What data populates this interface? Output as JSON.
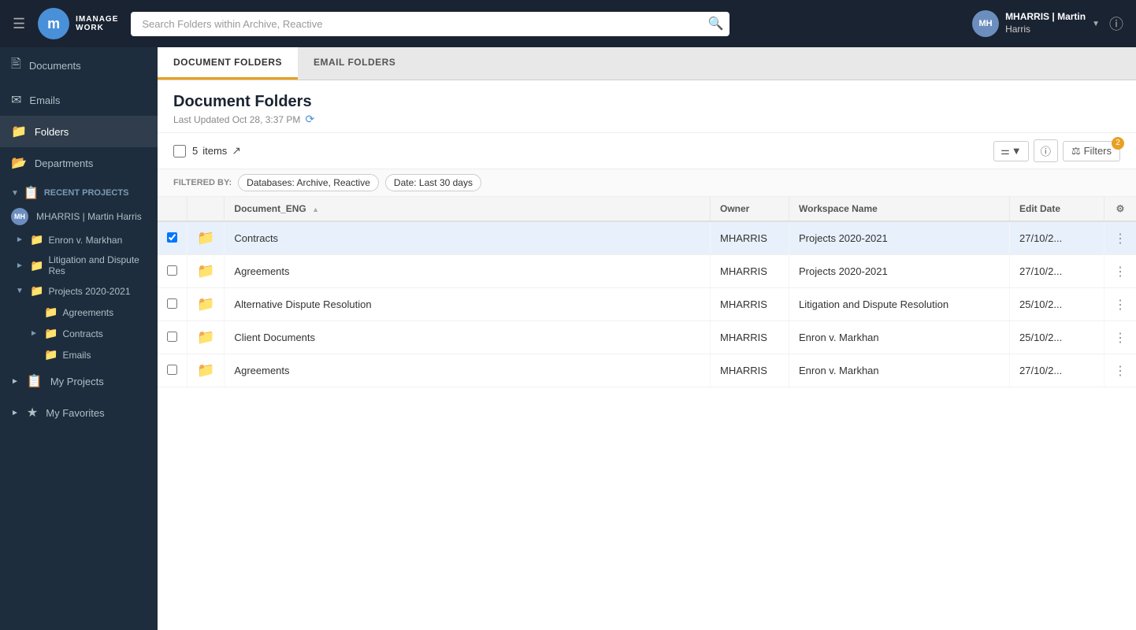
{
  "app": {
    "logo_letter": "m",
    "logo_brand": "iManage",
    "logo_product": "Work"
  },
  "topbar": {
    "search_placeholder": "Search Folders within Archive, Reactive",
    "user_initials": "MH",
    "user_username": "MHARRIS | Martin",
    "user_fullname": "Harris",
    "user_display": "MHARRIS | Martin Harris"
  },
  "sidebar": {
    "documents_label": "Documents",
    "emails_label": "Emails",
    "folders_label": "Folders",
    "departments_label": "Departments",
    "recent_projects_label": "Recent Projects",
    "my_projects_label": "My Projects",
    "my_favorites_label": "My Favorites",
    "user_label": "MHARRIS | Martin Harris",
    "tree": {
      "enron": "Enron v. Markhan",
      "litigation": "Litigation and Dispute Res",
      "projects": "Projects 2020-2021",
      "agreements": "Agreements",
      "contracts": "Contracts",
      "emails": "Emails"
    }
  },
  "tabs": {
    "document_folders": "DOCUMENT FOLDERS",
    "email_folders": "EMAIL FOLDERS"
  },
  "content": {
    "title": "Document Folders",
    "last_updated_label": "Last Updated Oct 28, 3:37 PM",
    "items_count": "5",
    "items_label": "items"
  },
  "filter": {
    "filtered_by_label": "FILTERED BY:",
    "chip1": "Databases: Archive, Reactive",
    "chip2": "Date: Last 30 days"
  },
  "toolbar": {
    "filter_label": "Filters",
    "filter_count": "2"
  },
  "table": {
    "col_document": "Document_ENG",
    "col_owner": "Owner",
    "col_workspace": "Workspace Name",
    "col_edit_date": "Edit Date",
    "rows": [
      {
        "id": 1,
        "name": "Contracts",
        "owner": "MHARRIS",
        "workspace": "Projects 2020-2021",
        "edit_date": "27/10/2...",
        "selected": true
      },
      {
        "id": 2,
        "name": "Agreements",
        "owner": "MHARRIS",
        "workspace": "Projects 2020-2021",
        "edit_date": "27/10/2...",
        "selected": false
      },
      {
        "id": 3,
        "name": "Alternative Dispute Resolution",
        "owner": "MHARRIS",
        "workspace": "Litigation and Dispute Resolution",
        "edit_date": "25/10/2...",
        "selected": false
      },
      {
        "id": 4,
        "name": "Client Documents",
        "owner": "MHARRIS",
        "workspace": "Enron v. Markhan",
        "edit_date": "25/10/2...",
        "selected": false
      },
      {
        "id": 5,
        "name": "Agreements",
        "owner": "MHARRIS",
        "workspace": "Enron v. Markhan",
        "edit_date": "27/10/2...",
        "selected": false
      }
    ]
  }
}
